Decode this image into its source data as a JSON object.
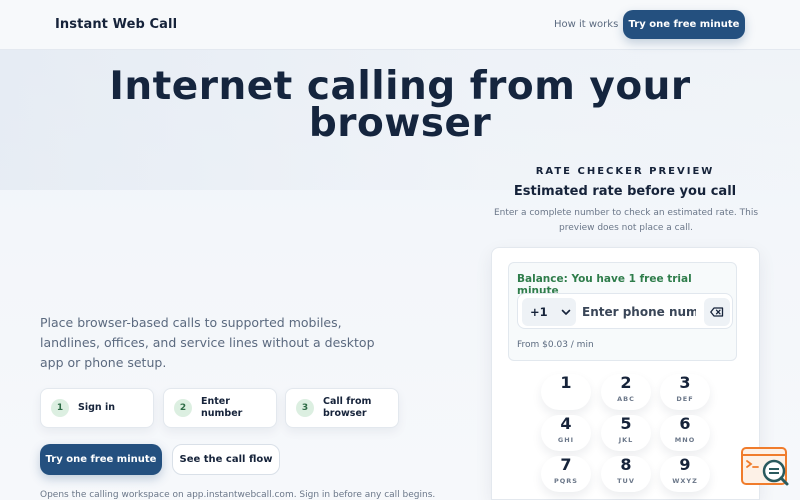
{
  "header": {
    "brand": "Instant Web Call",
    "nav_link": "How it works",
    "cta": "Try one free minute"
  },
  "hero": {
    "title_line1": "Internet calling from your",
    "title_line2": "browser",
    "subtitle": "Place browser-based calls to supported mobiles, landlines, offices, and service lines without a desktop app or phone setup.",
    "steps": [
      {
        "num": "1",
        "label": "Sign in"
      },
      {
        "num": "2",
        "label_line1": "Enter",
        "label_line2": "number"
      },
      {
        "num": "3",
        "label_line1": "Call from",
        "label_line2": "browser"
      }
    ],
    "primary_button": "Try one free minute",
    "secondary_button": "See the call flow",
    "footnote": "Opens the calling workspace on app.instantwebcall.com. Sign in before any call begins."
  },
  "rate_checker": {
    "kicker": "RATE CHECKER PREVIEW",
    "title": "Estimated rate before you call",
    "description": "Enter a complete number to check an estimated rate. This preview does not place a call.",
    "balance": "Balance: You have 1 free trial minute",
    "country_code": "+1",
    "phone_placeholder": "Enter phone number",
    "phone_value": "",
    "rate": "From $0.03 / min",
    "keys": [
      {
        "digit": "1",
        "letters": ""
      },
      {
        "digit": "2",
        "letters": "ABC"
      },
      {
        "digit": "3",
        "letters": "DEF"
      },
      {
        "digit": "4",
        "letters": "GHI"
      },
      {
        "digit": "5",
        "letters": "JKL"
      },
      {
        "digit": "6",
        "letters": "MNO"
      },
      {
        "digit": "7",
        "letters": "PQRS"
      },
      {
        "digit": "8",
        "letters": "TUV"
      },
      {
        "digit": "9",
        "letters": "WXYZ"
      }
    ]
  },
  "icons": {
    "country_dropdown": "chevron-down-icon",
    "backspace": "backspace-icon",
    "badge": "search-code-icon"
  },
  "colors": {
    "primary": "#24507f",
    "balance_green": "#2f7d4b",
    "step_badge_bg": "#dcefe1",
    "badge_orange": "#f07c2c",
    "badge_teal": "#2a5a5e"
  }
}
